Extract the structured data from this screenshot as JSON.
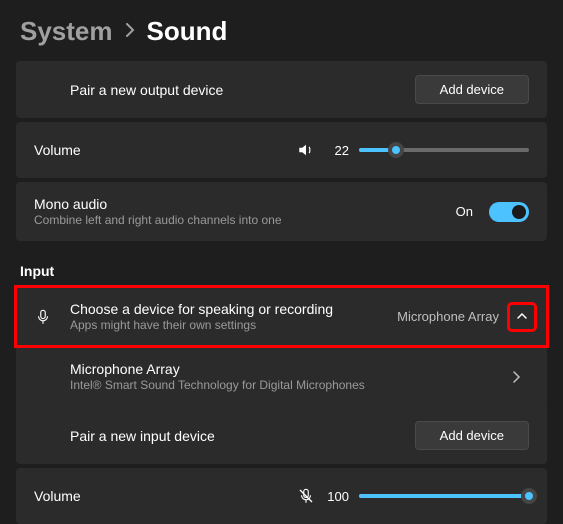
{
  "breadcrumb": {
    "parent": "System",
    "current": "Sound"
  },
  "output": {
    "pair_title": "Pair a new output device",
    "add_button": "Add device",
    "volume_label": "Volume",
    "volume_value": "22",
    "volume_percent": 22,
    "volume_icon": "speaker-icon"
  },
  "mono": {
    "title": "Mono audio",
    "subtitle": "Combine left and right audio channels into one",
    "state_label": "On"
  },
  "input_section_label": "Input",
  "input": {
    "choose_title": "Choose a device for speaking or recording",
    "choose_subtitle": "Apps might have their own settings",
    "choose_value": "Microphone Array",
    "choose_icon": "microphone-icon",
    "device_title": "Microphone Array",
    "device_subtitle": "Intel® Smart Sound Technology for Digital Microphones",
    "pair_title": "Pair a new input device",
    "add_button": "Add device",
    "volume_label": "Volume",
    "volume_value": "100",
    "volume_percent": 100,
    "volume_icon": "microphone-muted-icon"
  }
}
